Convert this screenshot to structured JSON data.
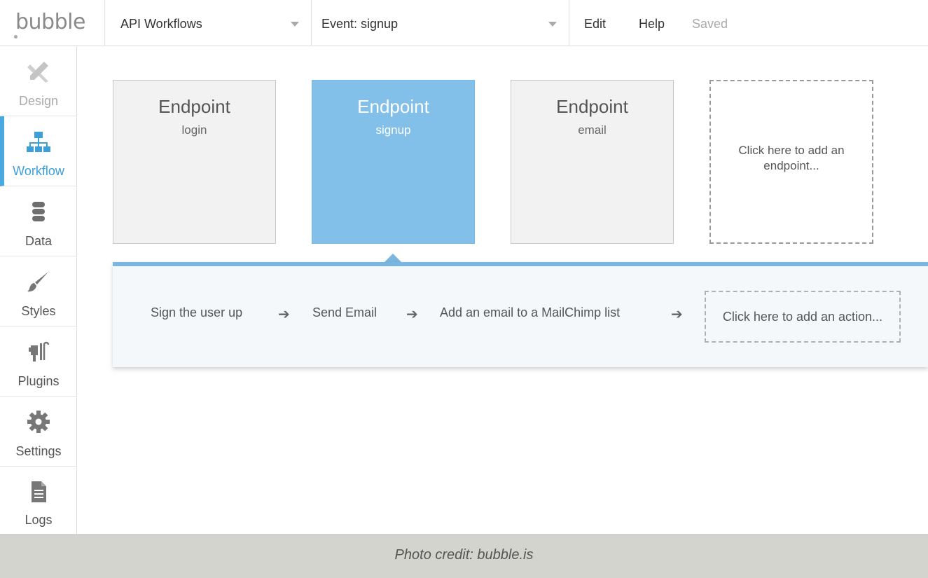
{
  "app": {
    "logo_text": "bubble"
  },
  "header": {
    "workflow_select": "API Workflows",
    "event_select": "Event: signup",
    "menu": [
      "Edit",
      "Help"
    ],
    "status": "Saved"
  },
  "sidebar": {
    "items": [
      {
        "label": "Design",
        "icon": "design-icon",
        "state": "disabled"
      },
      {
        "label": "Workflow",
        "icon": "workflow-icon",
        "state": "active"
      },
      {
        "label": "Data",
        "icon": "database-icon",
        "state": "normal"
      },
      {
        "label": "Styles",
        "icon": "brush-icon",
        "state": "normal"
      },
      {
        "label": "Plugins",
        "icon": "plug-icon",
        "state": "normal"
      },
      {
        "label": "Settings",
        "icon": "gear-icon",
        "state": "normal"
      },
      {
        "label": "Logs",
        "icon": "document-icon",
        "state": "normal"
      }
    ]
  },
  "endpoints": [
    {
      "title": "Endpoint",
      "name": "login",
      "selected": false
    },
    {
      "title": "Endpoint",
      "name": "signup",
      "selected": true
    },
    {
      "title": "Endpoint",
      "name": "email",
      "selected": false
    }
  ],
  "add_endpoint": "Click here to add an endpoint...",
  "actions": [
    "Sign the user up",
    "Send Email",
    "Add an email to a MailChimp list"
  ],
  "add_action": "Click here to add an action...",
  "footer": {
    "credit": "Photo credit: bubble.is"
  },
  "colors": {
    "accent": "#4aa8e0",
    "selected_card": "#82c0ea",
    "panel_border": "#7ab6e0"
  }
}
